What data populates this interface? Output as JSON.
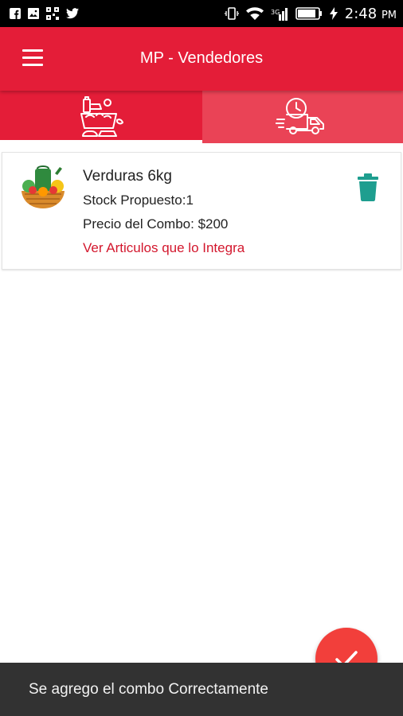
{
  "status_bar": {
    "time": "2:48",
    "ampm": "PM",
    "icons_left": [
      "facebook-icon",
      "image-icon",
      "qr-icon",
      "twitter-icon"
    ],
    "icons_right": [
      "vibrate-icon",
      "wifi-icon",
      "signal-icon",
      "battery-icon",
      "charging-icon"
    ]
  },
  "app_bar": {
    "title": "MP - Vendedores",
    "menu_icon": "menu-icon",
    "color": "#e41d38"
  },
  "tabs": [
    {
      "icon": "groceries-icon",
      "selected": true
    },
    {
      "icon": "delivery-truck-icon",
      "selected": false
    }
  ],
  "combo_card": {
    "image_icon": "vegetable-basket-icon",
    "title": "Verduras 6kg",
    "stock": "Stock Propuesto:1",
    "price": "Precio del Combo: $200",
    "link": "Ver Articulos que lo Integra",
    "delete_icon": "trash-icon",
    "link_color": "#d3172d",
    "delete_color": "#1e9e8f"
  },
  "fab": {
    "icon": "check-icon",
    "color": "#f23f3b"
  },
  "snackbar": {
    "message": "Se agrego el combo Correctamente"
  }
}
